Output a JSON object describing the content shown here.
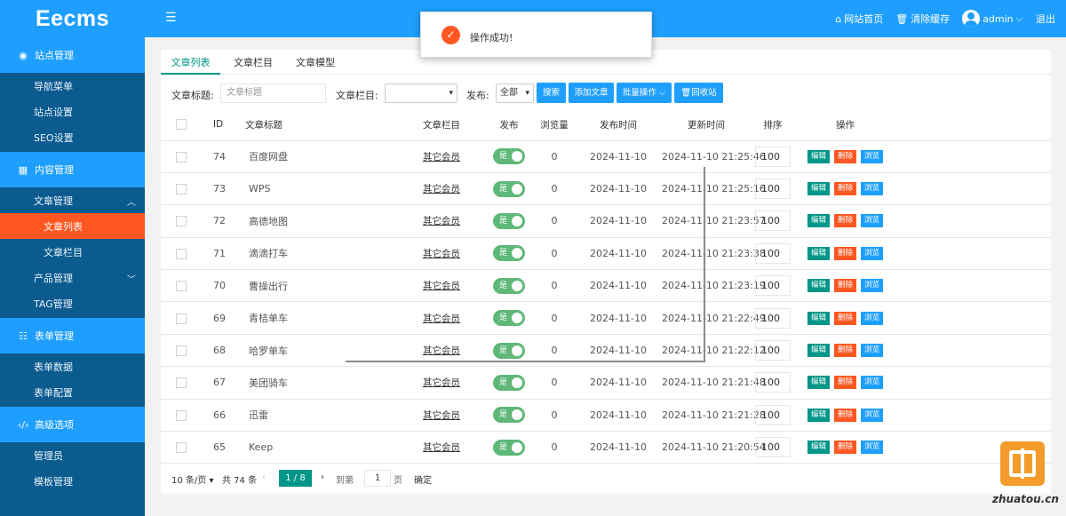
{
  "app": {
    "logo": "Eecms",
    "toggle_icon": "menu-fold-icon",
    "header": {
      "site_home": "网站首页",
      "clear_cache": "清除缓存",
      "user": "admin",
      "logout": "退出"
    }
  },
  "sidebar": {
    "groups": [
      {
        "icon": "globe-icon",
        "label": "站点管理"
      },
      {
        "icon": "content-icon",
        "label": "内容管理"
      },
      {
        "icon": "form-icon",
        "label": "表单管理"
      },
      {
        "icon": "code-icon",
        "label": "高级选项"
      }
    ],
    "items": {
      "nav_menu": "导航菜单",
      "site_settings": "站点设置",
      "seo_settings": "SEO设置",
      "article_mgmt": "文章管理",
      "article_list": "文章列表",
      "article_category": "文章栏目",
      "product_mgmt": "产品管理",
      "tag_mgmt": "TAG管理",
      "form_data": "表单数据",
      "form_config": "表单配置",
      "admin": "管理员",
      "template_mgmt": "模板管理"
    }
  },
  "tabs": [
    "文章列表",
    "文章栏目",
    "文章模型"
  ],
  "filter": {
    "title_label": "文章标题:",
    "title_placeholder": "文章标题",
    "category_label": "文章栏目:",
    "category_value": "",
    "publish_label": "发布:",
    "publish_value": "全部",
    "search_btn": "搜索",
    "add_btn": "添加文章",
    "batch_btn": "批量操作",
    "recycle_btn": "回收站"
  },
  "table": {
    "headers": [
      "ID",
      "文章标题",
      "文章栏目",
      "发布",
      "浏览量",
      "发布时间",
      "更新时间",
      "排序",
      "操作"
    ],
    "action_labels": {
      "edit": "编辑",
      "delete": "删除",
      "view": "浏览"
    },
    "switch_label": "是",
    "rows": [
      {
        "id": "74",
        "title": "百度网盘",
        "category": "其它会员",
        "views": "0",
        "pub": "2024-11-10",
        "upd": "2024-11-10 21:25:46",
        "sort": "100"
      },
      {
        "id": "73",
        "title": "WPS",
        "category": "其它会员",
        "views": "0",
        "pub": "2024-11-10",
        "upd": "2024-11-10 21:25:16",
        "sort": "100"
      },
      {
        "id": "72",
        "title": "高德地图",
        "category": "其它会员",
        "views": "0",
        "pub": "2024-11-10",
        "upd": "2024-11-10 21:23:57",
        "sort": "100"
      },
      {
        "id": "71",
        "title": "滴滴打车",
        "category": "其它会员",
        "views": "0",
        "pub": "2024-11-10",
        "upd": "2024-11-10 21:23:38",
        "sort": "100"
      },
      {
        "id": "70",
        "title": "曹操出行",
        "category": "其它会员",
        "views": "0",
        "pub": "2024-11-10",
        "upd": "2024-11-10 21:23:19",
        "sort": "100"
      },
      {
        "id": "69",
        "title": "青桔单车",
        "category": "其它会员",
        "views": "0",
        "pub": "2024-11-10",
        "upd": "2024-11-10 21:22:49",
        "sort": "100"
      },
      {
        "id": "68",
        "title": "哈罗单车",
        "category": "其它会员",
        "views": "0",
        "pub": "2024-11-10",
        "upd": "2024-11-10 21:22:12",
        "sort": "100"
      },
      {
        "id": "67",
        "title": "美团骑车",
        "category": "其它会员",
        "views": "0",
        "pub": "2024-11-10",
        "upd": "2024-11-10 21:21:48",
        "sort": "100"
      },
      {
        "id": "66",
        "title": "迅雷",
        "category": "其它会员",
        "views": "0",
        "pub": "2024-11-10",
        "upd": "2024-11-10 21:21:28",
        "sort": "100"
      },
      {
        "id": "65",
        "title": "Keep",
        "category": "其它会员",
        "views": "0",
        "pub": "2024-11-10",
        "upd": "2024-11-10 21:20:54",
        "sort": "100"
      }
    ]
  },
  "pager": {
    "page_size": "10 条/页",
    "total": "共 74 条",
    "current": "1 / 8",
    "goto_label": "到第",
    "goto_value": "1",
    "page_unit": "页",
    "confirm": "确定"
  },
  "toast": {
    "message": "操作成功!"
  },
  "watermark": {
    "text": "zhuatou.cn"
  },
  "colors": {
    "primary": "#1e9fff",
    "sidebar": "#0b5b8f",
    "active": "#ff5722",
    "green": "#009688",
    "switch": "#5fb878"
  }
}
